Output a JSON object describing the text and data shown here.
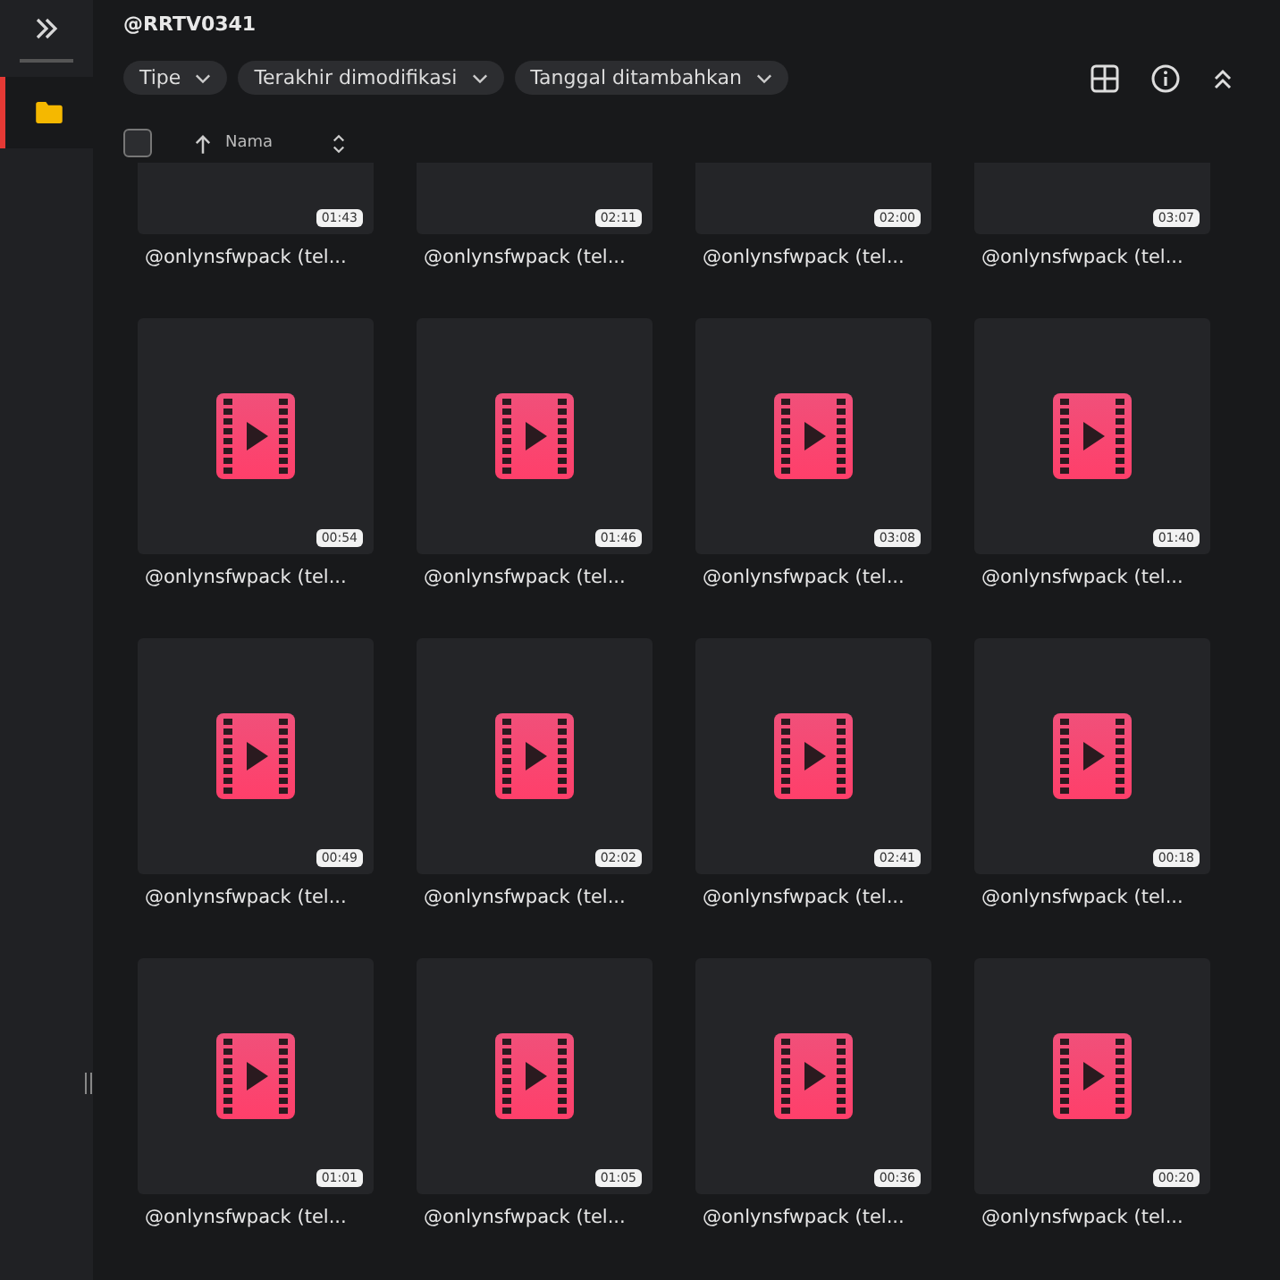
{
  "title": "@RRTV0341",
  "sidebar": {
    "items": [
      {
        "kind": "folder",
        "selected": true
      }
    ]
  },
  "filters": [
    {
      "label": "Tipe"
    },
    {
      "label": "Terakhir dimodifikasi"
    },
    {
      "label": "Tanggal ditambahkan"
    }
  ],
  "list_header": {
    "select_all_checked": false,
    "sort_label": "Nama"
  },
  "rows": [
    {
      "cut": true,
      "items": [
        {
          "name": "@onlynsfwpack (tel...",
          "duration": "01:43"
        },
        {
          "name": "@onlynsfwpack (tel...",
          "duration": "02:11"
        },
        {
          "name": "@onlynsfwpack (tel...",
          "duration": "02:00"
        },
        {
          "name": "@onlynsfwpack (tel...",
          "duration": "03:07"
        }
      ]
    },
    {
      "cut": false,
      "items": [
        {
          "name": "@onlynsfwpack (tel...",
          "duration": "00:54"
        },
        {
          "name": "@onlynsfwpack (tel...",
          "duration": "01:46"
        },
        {
          "name": "@onlynsfwpack (tel...",
          "duration": "03:08"
        },
        {
          "name": "@onlynsfwpack (tel...",
          "duration": "01:40"
        }
      ]
    },
    {
      "cut": false,
      "items": [
        {
          "name": "@onlynsfwpack (tel...",
          "duration": "00:49"
        },
        {
          "name": "@onlynsfwpack (tel...",
          "duration": "02:02"
        },
        {
          "name": "@onlynsfwpack (tel...",
          "duration": "02:41"
        },
        {
          "name": "@onlynsfwpack (tel...",
          "duration": "00:18"
        }
      ]
    },
    {
      "cut": false,
      "items": [
        {
          "name": "@onlynsfwpack (tel...",
          "duration": "01:01"
        },
        {
          "name": "@onlynsfwpack (tel...",
          "duration": "01:05"
        },
        {
          "name": "@onlynsfwpack (tel...",
          "duration": "00:36"
        },
        {
          "name": "@onlynsfwpack (tel...",
          "duration": "00:20"
        }
      ]
    }
  ]
}
